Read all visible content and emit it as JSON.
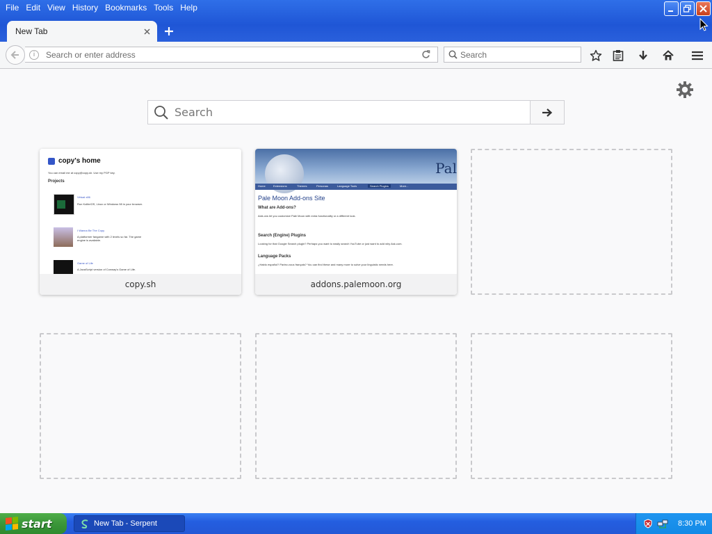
{
  "menubar": {
    "items": [
      "File",
      "Edit",
      "View",
      "History",
      "Bookmarks",
      "Tools",
      "Help"
    ]
  },
  "tab": {
    "label": "New Tab"
  },
  "navbar": {
    "address_placeholder": "Search or enter address",
    "search_placeholder": "Search"
  },
  "newtab": {
    "search_placeholder": "Search",
    "tiles": [
      {
        "title": "copy.sh",
        "thumbnail": {
          "heading": "copy's home",
          "intro": "You can email me at copy@copy.sh. Use my PGP key.",
          "section": "Projects",
          "projects": [
            {
              "name": "Virtual x86",
              "desc": "Run KolibriOS, Linux or Windows 98 in your browser."
            },
            {
              "name": "I Wanna Be The Copy",
              "desc": "A platformer fangame with 2 levels so far. The game engine is available."
            },
            {
              "name": "Game of Life",
              "desc": "A JavaScript version of Conway's Game of Life."
            }
          ]
        }
      },
      {
        "title": "addons.palemoon.org",
        "thumbnail": {
          "banner_text": "Pal",
          "nav": [
            "Home",
            "Extensions",
            "Themes",
            "Personas",
            "Language Tools",
            "Search Plugins",
            "More..."
          ],
          "heading": "Pale Moon Add-ons Site",
          "sections": [
            {
              "h": "What are Add-ons?",
              "p": "Add-ons let you customize Pale Moon with extra functionality or a different look."
            },
            {
              "h": "Search (Engine) Plugins",
              "p": "Looking for that Google Search plugin? Perhaps you want to easily search YouTube or just want to add why Ask.com."
            },
            {
              "h": "Language Packs",
              "p": "¿Hablo español? Parlez-vous français? You can find these and many more to solve your linguistic needs here."
            }
          ]
        }
      }
    ]
  },
  "taskbar": {
    "start_label": "start",
    "task_label": "New Tab - Serpent",
    "clock": "8:30 PM"
  },
  "colors": {
    "xp_blue": "#245ee0",
    "start_green": "#3b963a",
    "page_bg": "#f9f9fa"
  }
}
